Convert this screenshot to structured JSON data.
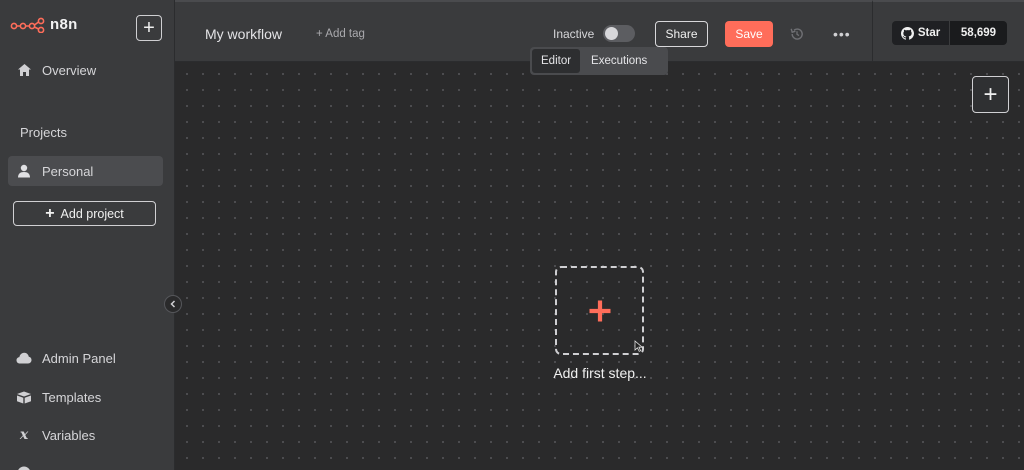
{
  "brand": {
    "name": "n8n",
    "color": "#ff6d5a"
  },
  "sidebar": {
    "new_icon": "plus-icon",
    "overview": {
      "label": "Overview",
      "icon": "home-icon"
    },
    "projects_label": "Projects",
    "personal": {
      "label": "Personal",
      "icon": "user-icon"
    },
    "add_project": "Add project",
    "bottom_items": [
      {
        "label": "Admin Panel",
        "icon": "cloud-icon"
      },
      {
        "label": "Templates",
        "icon": "box-icon"
      },
      {
        "label": "Variables",
        "icon": "variable-icon"
      }
    ]
  },
  "header": {
    "workflow_name": "My workflow",
    "add_tag": "+ Add tag",
    "status_label": "Inactive",
    "active": false,
    "share_label": "Share",
    "save_label": "Save",
    "tabs": [
      {
        "label": "Editor",
        "active": true
      },
      {
        "label": "Executions",
        "active": false
      }
    ]
  },
  "github": {
    "star_label": "Star",
    "count": "58,699"
  },
  "canvas": {
    "add_first_step": "Add first step..."
  }
}
